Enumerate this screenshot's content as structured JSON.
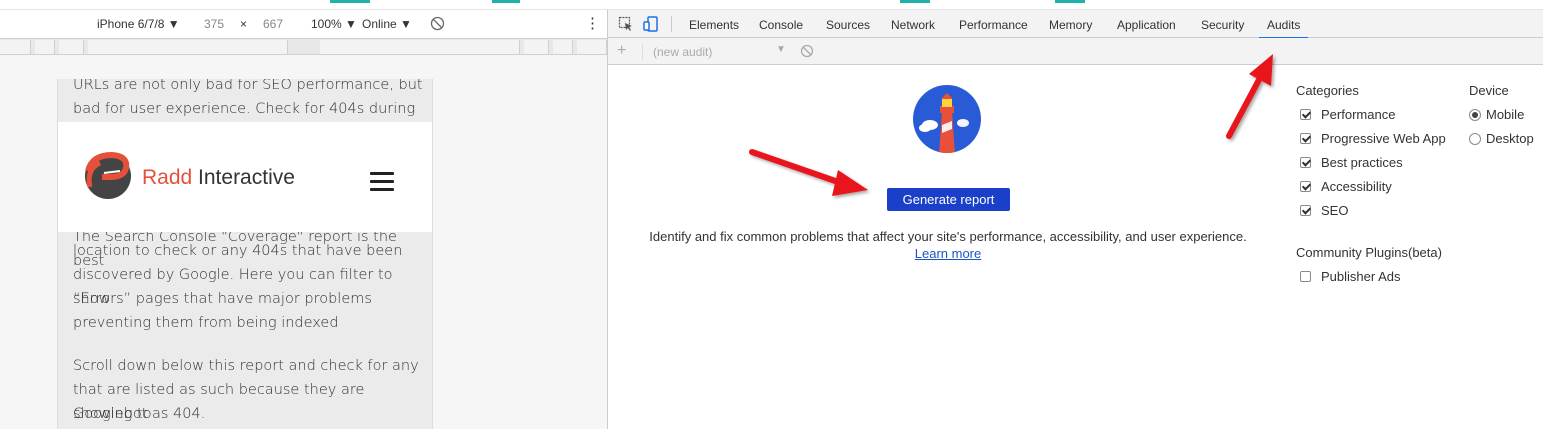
{
  "device_toolbar": {
    "device": "iPhone 6/7/8",
    "width": "375",
    "times": "×",
    "height": "667",
    "zoom": "100%",
    "network": "Online",
    "more": "⋮"
  },
  "phone": {
    "text_top_1": "URLs are not only bad for SEO performance, but",
    "text_top_2": "bad for user experience. Check for 404s during",
    "logo_part1": "Radd",
    "logo_part2": " Interactive",
    "text_lines": [
      "The Search Console \"Coverage\" report is the best",
      "location to check or any 404s that have been",
      "discovered by Google. Here you can filter to show",
      "“Errors” pages that have major problems",
      "preventing them from being indexed"
    ],
    "text_lines_2": [
      "Scroll down below this report and check for any",
      "that are listed as such because they are showing to",
      "Googlebot as 404."
    ]
  },
  "devtools": {
    "tabs": [
      "Elements",
      "Console",
      "Sources",
      "Network",
      "Performance",
      "Memory",
      "Application",
      "Security",
      "Audits"
    ],
    "active_tab": "Audits",
    "subbar": {
      "plus": "+",
      "select_placeholder": "(new audit)"
    },
    "generate_label": "Generate report",
    "description": "Identify and fix common problems that affect your site's performance, accessibility, and user experience.",
    "learn_more": "Learn more",
    "categories_heading": "Categories",
    "categories": [
      {
        "label": "Performance",
        "checked": true
      },
      {
        "label": "Progressive Web App",
        "checked": true
      },
      {
        "label": "Best practices",
        "checked": true
      },
      {
        "label": "Accessibility",
        "checked": true
      },
      {
        "label": "SEO",
        "checked": true
      }
    ],
    "device_heading": "Device",
    "devices": [
      {
        "label": "Mobile",
        "checked": true
      },
      {
        "label": "Desktop",
        "checked": false
      }
    ],
    "plugins_heading": "Community Plugins(beta)",
    "plugins": [
      {
        "label": "Publisher Ads",
        "checked": false
      }
    ]
  },
  "colors": {
    "accent": "#1a73e8",
    "button": "#1a3fc8",
    "arrow": "#e8141b",
    "brand_red": "#e4503a"
  }
}
